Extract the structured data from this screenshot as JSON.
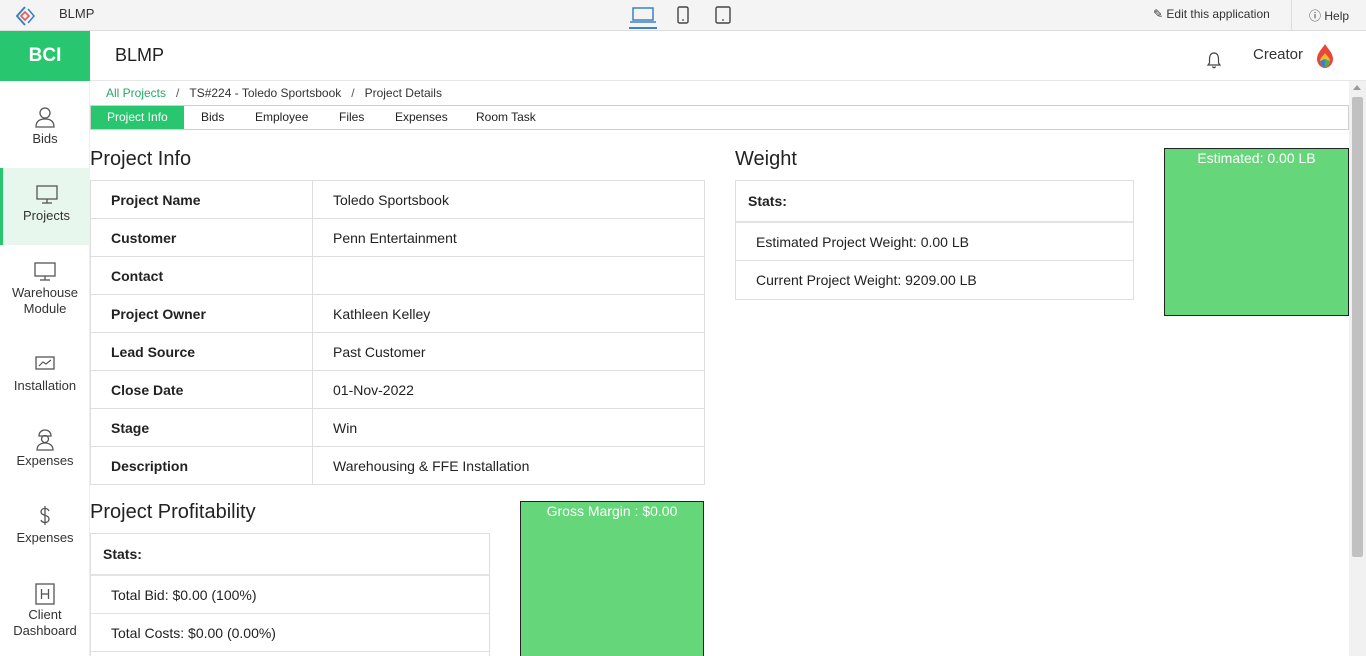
{
  "topbar": {
    "app_title": "BLMP",
    "edit_label": "Edit this application",
    "help_label": "Help",
    "devices": [
      "laptop-icon",
      "mobile-icon",
      "tablet-icon"
    ]
  },
  "brand": {
    "text": "BCI",
    "color": "#28c76f"
  },
  "header": {
    "app_name": "BLMP",
    "user_label": "Creator"
  },
  "sidebar": {
    "items": [
      {
        "label": "Bids",
        "icon": "user-icon"
      },
      {
        "label": "Projects",
        "icon": "monitor-icon",
        "active": true
      },
      {
        "label": "Warehouse Module",
        "icon": "monitor-icon"
      },
      {
        "label": "Installation",
        "icon": "chart-monitor-icon"
      },
      {
        "label": "Expenses",
        "icon": "worker-icon"
      },
      {
        "label": "Expenses",
        "icon": "dollar-icon"
      },
      {
        "label": "Client Dashboard",
        "icon": "h-box-icon"
      }
    ]
  },
  "breadcrumb": {
    "all_projects": "All Projects",
    "project": "TS#224 - Toledo Sportsbook",
    "current": "Project Details"
  },
  "tabs": [
    "Project Info",
    "Bids",
    "Employee",
    "Files",
    "Expenses",
    "Room Task"
  ],
  "project_info": {
    "title": "Project Info",
    "rows": [
      {
        "label": "Project Name",
        "value": "Toledo Sportsbook"
      },
      {
        "label": "Customer",
        "value": "Penn Entertainment"
      },
      {
        "label": "Contact",
        "value": ""
      },
      {
        "label": "Project Owner",
        "value": "Kathleen Kelley"
      },
      {
        "label": "Lead Source",
        "value": "Past Customer"
      },
      {
        "label": "Close Date",
        "value": "01-Nov-2022"
      },
      {
        "label": "Stage",
        "value": "Win"
      },
      {
        "label": "Description",
        "value": "Warehousing & FFE Installation"
      }
    ]
  },
  "weight": {
    "title": "Weight",
    "stats_label": "Stats:",
    "estimated": "Estimated Project Weight: 0.00 LB",
    "current": "Current Project Weight: 9209.00 LB",
    "box_label": "Estimated: 0.00 LB"
  },
  "profitability": {
    "title": "Project Profitability",
    "stats_label": "Stats:",
    "total_bid": "Total Bid: $0.00 (100%)",
    "total_costs": "Total Costs: $0.00 (0.00%)",
    "box_label": "Gross Margin : $0.00"
  },
  "colors": {
    "accent": "#28c76f",
    "box_green": "#66d67b",
    "link": "#28a865"
  }
}
